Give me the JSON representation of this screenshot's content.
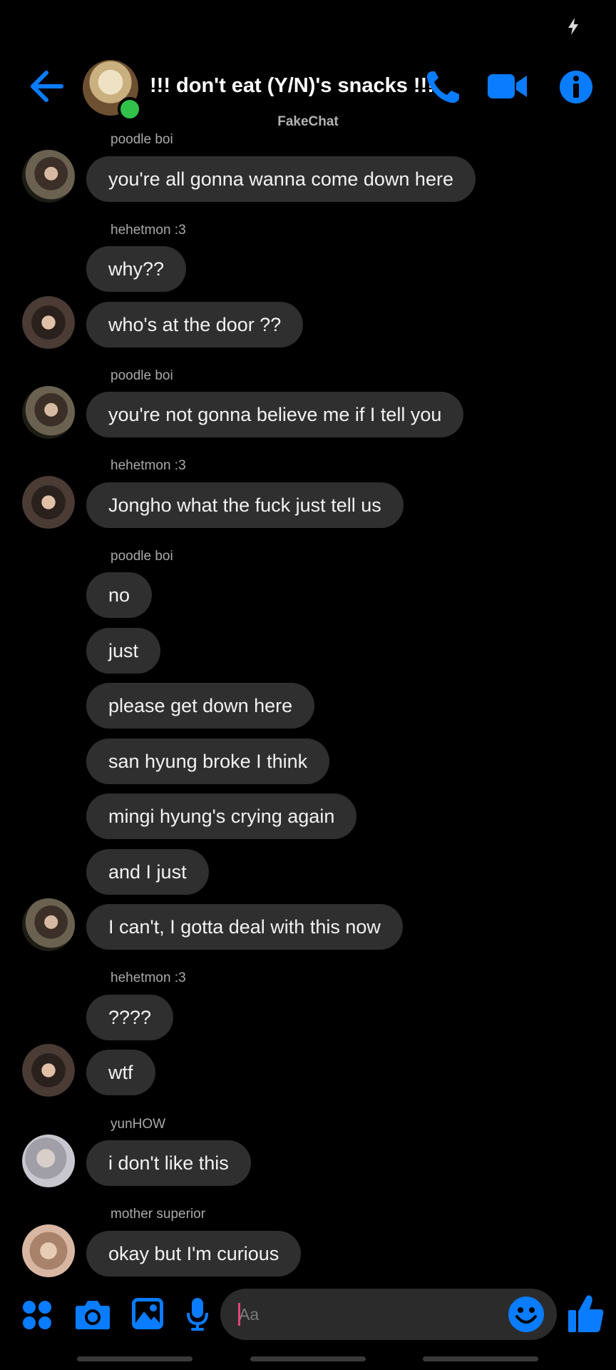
{
  "theme": {
    "accent": "#0a7cff",
    "bubble": "#2f2f2f",
    "online": "#31c24a",
    "background": "#000000"
  },
  "status_bar": {
    "icon": "bolt-icon"
  },
  "header": {
    "title": "!!! don't eat (Y/N)'s snacks !!!",
    "back_icon": "arrow-left-icon",
    "call_icon": "phone-icon",
    "video_icon": "video-camera-icon",
    "info_icon": "info-icon"
  },
  "watermark": "FakeChat",
  "messages": [
    {
      "sender": "poodle boi",
      "text": "you're all gonna wanna come down here"
    },
    {
      "sender": "hehetmon :3",
      "text": "why??"
    },
    {
      "text": "who's at the door ??"
    },
    {
      "sender": "poodle boi",
      "text": "you're not gonna believe me if I tell you"
    },
    {
      "sender": "hehetmon :3",
      "text": "Jongho what the fuck just tell us"
    },
    {
      "sender": "poodle boi",
      "text": "no"
    },
    {
      "text": "just"
    },
    {
      "text": "please get down here"
    },
    {
      "text": "san hyung broke I think"
    },
    {
      "text": "mingi hyung's crying again"
    },
    {
      "text": "and I just"
    },
    {
      "text": "I can't, I gotta deal with this now"
    },
    {
      "sender": "hehetmon :3",
      "text": "????"
    },
    {
      "text": "wtf"
    },
    {
      "sender": "yunHOW",
      "text": "i don't like this"
    },
    {
      "sender": "mother superior",
      "text": "okay but I'm curious"
    }
  ],
  "composer": {
    "placeholder": "Aa",
    "tools": [
      "apps-icon",
      "camera-icon",
      "gallery-icon",
      "microphone-icon"
    ],
    "emoji_icon": "emoji-icon",
    "send_icon": "thumbs-up-icon"
  }
}
